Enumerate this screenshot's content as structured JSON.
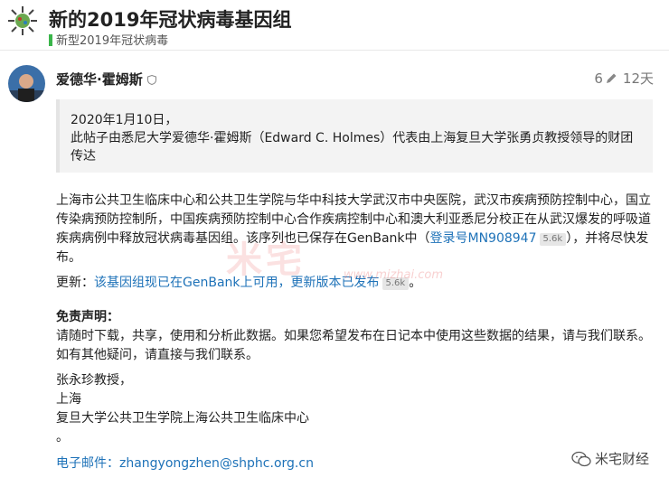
{
  "header": {
    "title": "新的2019年冠状病毒基因组",
    "category": "新型2019年冠状病毒"
  },
  "post": {
    "author": "爱德华·霍姆斯",
    "edit_count": "6",
    "age": "12天",
    "quote": {
      "line1": "2020年1月10日，",
      "line2": "此帖子由悉尼大学爱德华·霍姆斯（Edward C. Holmes）代表由上海复旦大学张勇贞教授领导的财团传达"
    },
    "body1_text": "上海市公共卫生临床中心和公共卫生学院与华中科技大学武汉市中央医院，武汉市疾病预防控制中心，国立传染病预防控制所，中国疾病预防控制中心合作疾病控制中心和澳大利亚悉尼分校正在从武汉爆发的呼吸道疾病病例中释放冠状病毒基因组。该序列也已保存在GenBank中（",
    "accession_link": "登录号MN908947",
    "accession_clicks": "5.6k",
    "body1_end": "），并将尽快发布。",
    "update_label": "更新：",
    "update_link": "该基因组现已在GenBank上可用，更新版本已发布",
    "update_clicks": "5.6k",
    "update_end": "。",
    "disclaimer_title": "免责声明：",
    "disclaimer_text": "请随时下载，共享，使用和分析此数据。如果您希望发布在日记本中使用这些数据的结果，请与我们联系。如有其他疑问，请直接与我们联系。",
    "sign_name": "张永珍教授，",
    "sign_city": "上海",
    "sign_org": "复旦大学公共卫生学院上海公共卫生临床中心",
    "sign_dot": "。",
    "email_label": "电子邮件：",
    "email": "zhangyongzhen@shphc.org.cn"
  },
  "overlay": {
    "watermark": "米宅",
    "watermark_url": "www.mizhai.com",
    "brand": "米宅财经"
  },
  "icons": {
    "logo": "virus-logo-icon",
    "shield": "shield-icon",
    "pencil": "pencil-icon",
    "brand": "wechat-icon"
  },
  "colors": {
    "link": "#1e72b8",
    "category": "#3ab54a"
  }
}
